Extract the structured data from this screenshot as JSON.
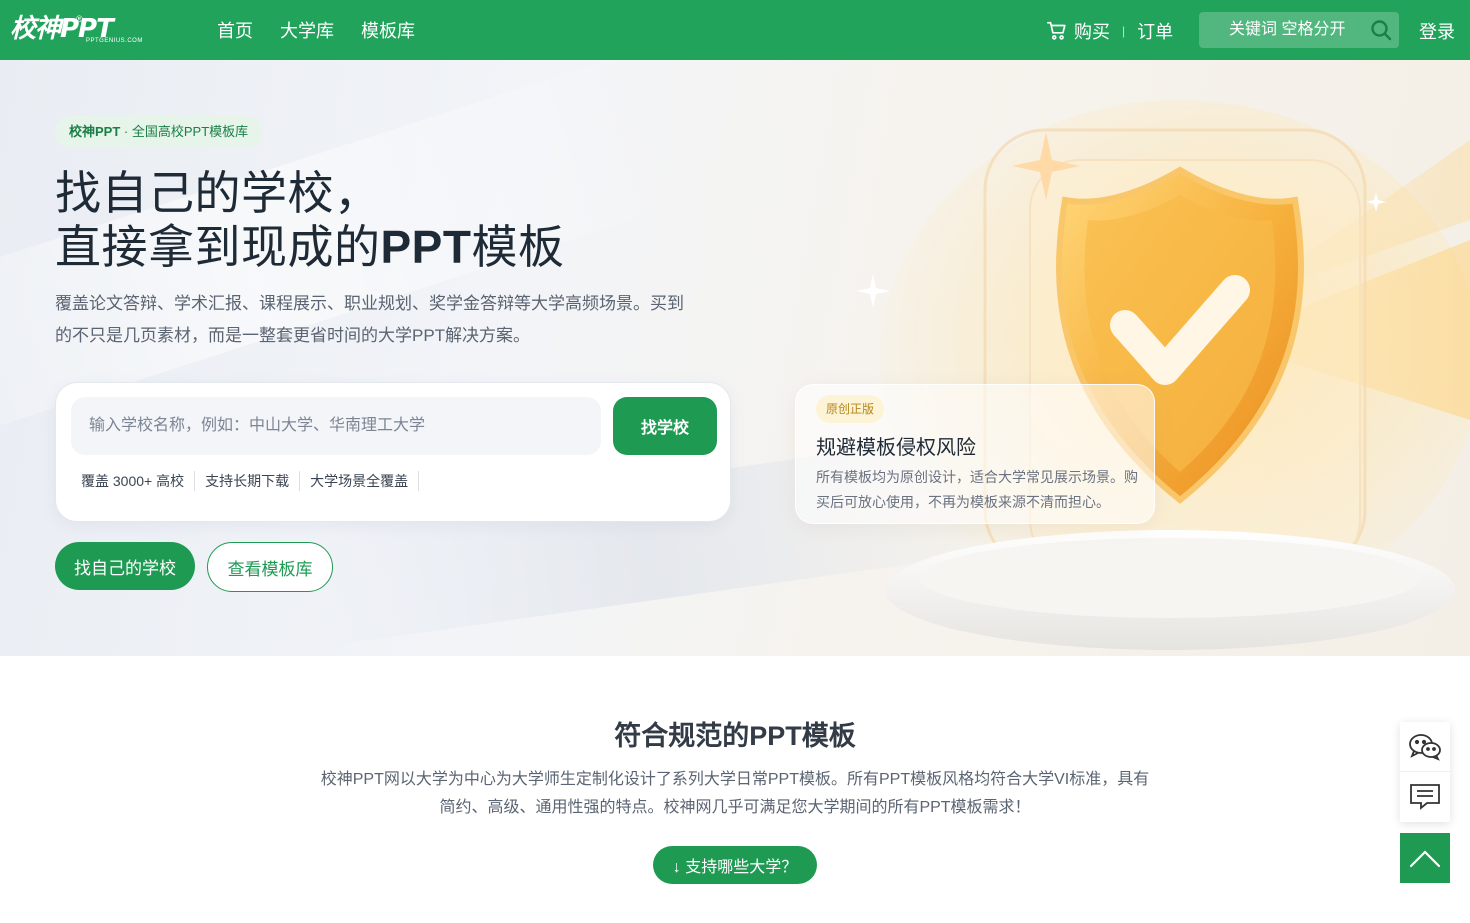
{
  "header": {
    "logo_text": "校神PPT",
    "logo_reg": "®",
    "logo_sub": "PPTGENIUS.COM",
    "nav": [
      "首页",
      "大学库",
      "模板库"
    ],
    "cart_label": "购买",
    "separator": "|",
    "orders_label": "订单",
    "search_placeholder": "关键词 空格分开",
    "login_label": "登录",
    "brand_color": "#22a35c"
  },
  "hero": {
    "tag_brand": "校神PPT",
    "tag_rest": " · 全国高校PPT模板库",
    "title_line1": "找自己的学校，",
    "title_line2_a": "直接拿到现成的",
    "title_line2_b": "PPT",
    "title_line2_c": "模板",
    "description": "覆盖论文答辩、学术汇报、课程展示、职业规划、奖学金答辩等大学高频场景。买到的不只是几页素材，而是一整套更省时间的大学PPT解决方案。",
    "school_search_placeholder": "输入学校名称，例如：中山大学、华南理工大学",
    "find_button": "找学校",
    "features": [
      "覆盖 3000+ 高校",
      "支持长期下载",
      "大学场景全覆盖"
    ],
    "primary_button": "找自己的学校",
    "secondary_button": "查看模板库",
    "card": {
      "badge": "原创正版",
      "title": "规避模板侵权风险",
      "text": "所有模板均为原创设计，适合大学常见展示场景。购买后可放心使用，不再为模板来源不清而担心。"
    }
  },
  "section": {
    "title": "符合规范的PPT模板",
    "description": "校神PPT网以大学为中心为大学师生定制化设计了系列大学日常PPT模板。所有PPT模板风格均符合大学VI标准，具有简约、高级、通用性强的特点。校神网几乎可满足您大学期间的所有PPT模板需求！",
    "support_button": "↓ 支持哪些大学？"
  },
  "side": {
    "icons": [
      "wechat-icon",
      "message-icon",
      "back-to-top-icon"
    ]
  }
}
